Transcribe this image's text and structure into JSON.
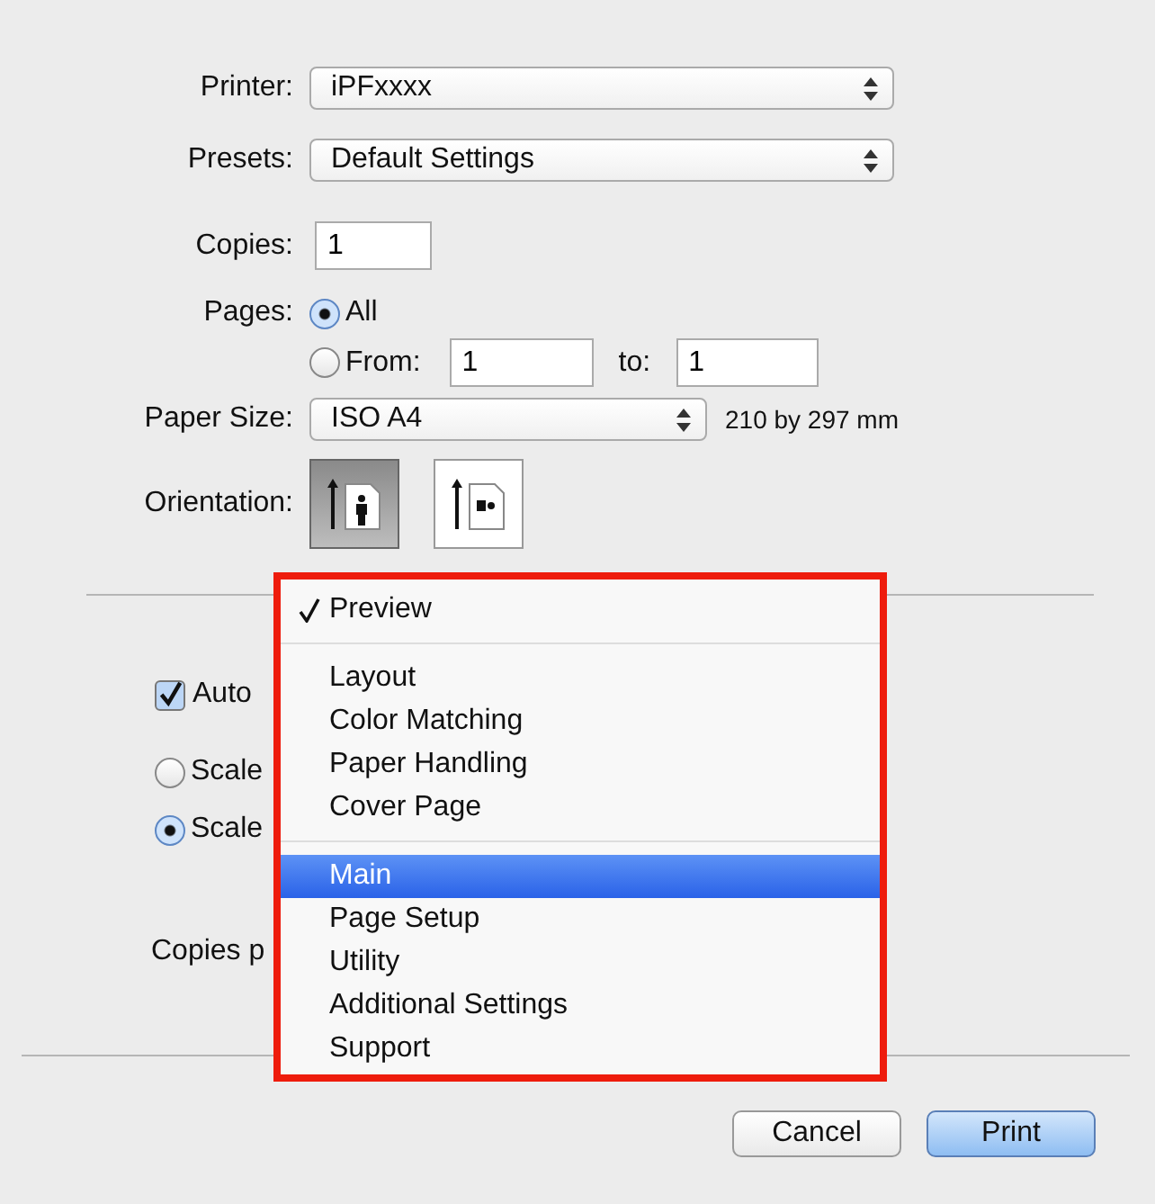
{
  "printer": {
    "label": "Printer:",
    "value": "iPFxxxx"
  },
  "presets": {
    "label": "Presets:",
    "value": "Default Settings"
  },
  "copies": {
    "label": "Copies:",
    "value": "1"
  },
  "pages": {
    "label": "Pages:",
    "options": [
      {
        "label": "All",
        "selected": true
      },
      {
        "label": "From:",
        "selected": false
      }
    ],
    "from": "1",
    "to_label": "to:",
    "to": "1"
  },
  "paper_size": {
    "label": "Paper Size:",
    "value": "ISO A4",
    "dimensions": "210 by 297 mm"
  },
  "orientation": {
    "label": "Orientation:",
    "options": [
      {
        "kind": "portrait",
        "selected": true
      },
      {
        "kind": "landscape",
        "selected": false
      }
    ]
  },
  "panel": {
    "auto_checkbox": {
      "label": "Auto",
      "checked": true
    },
    "scale_options": [
      {
        "label": "Scale",
        "selected": false
      },
      {
        "label": "Scale",
        "selected": true
      }
    ],
    "copies_per_label": "Copies p"
  },
  "menu": {
    "items": [
      {
        "kind": "item",
        "label": "Preview",
        "checked": true,
        "selected": false
      },
      {
        "kind": "separator"
      },
      {
        "kind": "item",
        "label": "Layout",
        "checked": false,
        "selected": false
      },
      {
        "kind": "item",
        "label": "Color Matching",
        "checked": false,
        "selected": false
      },
      {
        "kind": "item",
        "label": "Paper Handling",
        "checked": false,
        "selected": false
      },
      {
        "kind": "item",
        "label": "Cover Page",
        "checked": false,
        "selected": false
      },
      {
        "kind": "separator"
      },
      {
        "kind": "item",
        "label": "Main",
        "checked": false,
        "selected": true
      },
      {
        "kind": "item",
        "label": "Page Setup",
        "checked": false,
        "selected": false
      },
      {
        "kind": "item",
        "label": "Utility",
        "checked": false,
        "selected": false
      },
      {
        "kind": "item",
        "label": "Additional Settings",
        "checked": false,
        "selected": false
      },
      {
        "kind": "item",
        "label": "Support",
        "checked": false,
        "selected": false
      }
    ]
  },
  "buttons": [
    {
      "label": "Cancel",
      "default": false
    },
    {
      "label": "Print",
      "default": true
    }
  ]
}
